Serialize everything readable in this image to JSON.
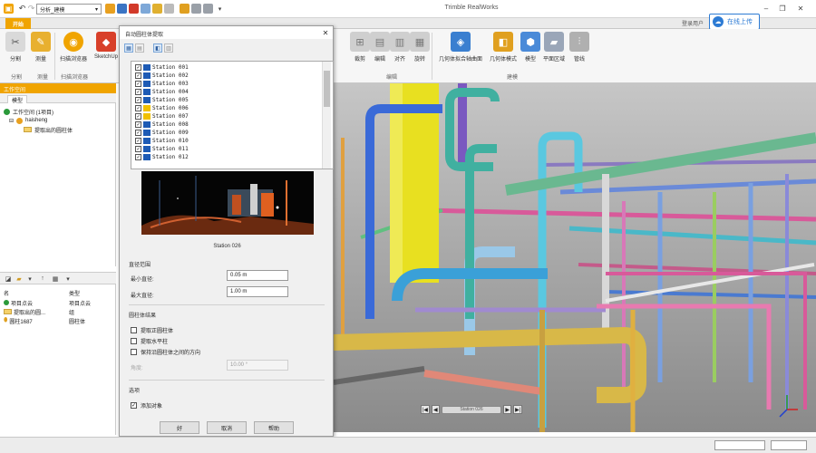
{
  "titlebar": {
    "project_combo": "分析_建模",
    "app_title": "Trimble RealWorks",
    "minimize": "–",
    "restore": "❐",
    "close": "✕"
  },
  "ribbon_tabs": {
    "home": "开始"
  },
  "account": {
    "user": "登录用户",
    "login_label": "在线上传"
  },
  "ribbon": {
    "left_buttons": [
      {
        "label": "分割",
        "icon": "cut-icon"
      },
      {
        "label": "测量",
        "icon": "measure-icon"
      },
      {
        "label": "扫描浏览器",
        "icon": "scan-explorer-icon"
      },
      {
        "label": "SketchUp",
        "icon": "sketchup-icon"
      }
    ],
    "left_groups": [
      "分割",
      "测量",
      "扫描浏览器"
    ],
    "right_buttons": [
      {
        "label": "裁剪"
      },
      {
        "label": "编辑"
      },
      {
        "label": "对齐"
      },
      {
        "label": "旋转"
      },
      {
        "label": "几何体拟合轴曲面"
      },
      {
        "label": "几何体模式"
      },
      {
        "label": "模型"
      },
      {
        "label": "平面区域"
      },
      {
        "label": "管线"
      }
    ],
    "right_groups": [
      "编辑",
      "建模"
    ]
  },
  "workspace": {
    "header": "工作空间",
    "tab": "模型",
    "tree": [
      {
        "label": "工作空间 (1项目)",
        "indent": 0
      },
      {
        "label": "haisheng",
        "indent": 1
      },
      {
        "label": "提取出的圆柱体",
        "indent": 2
      }
    ]
  },
  "properties": {
    "col_name": "名",
    "col_type": "类型",
    "rows": [
      {
        "name": "项目点云",
        "type": "项目点云"
      },
      {
        "name": "提取出的圆...",
        "type": "组"
      },
      {
        "name": "圆柱1687",
        "type": "圆柱体"
      }
    ]
  },
  "dialog": {
    "title": "自动圆柱体提取",
    "stations": [
      "Station 001",
      "Station 002",
      "Station 003",
      "Station 004",
      "Station 005",
      "Station 006",
      "Station 007",
      "Station 008",
      "Station 009",
      "Station 010",
      "Station 011",
      "Station 012"
    ],
    "preview_caption": "Station 026",
    "radius_section": "直径范围",
    "min_label": "最小直径:",
    "min_value": "0.05 m",
    "max_label": "最大直径:",
    "max_value": "1.00 m",
    "options_section": "圆柱体结果",
    "opt1": "提取正圆柱体",
    "opt2": "提取水平柱",
    "opt3": "保持沿圆柱体之间的方向",
    "angle_label": "角度:",
    "angle_value": "10.00 °",
    "output_section": "选项",
    "output_check": "添加对象",
    "btn_ok": "好",
    "btn_cancel": "取消",
    "btn_help": "帮助"
  },
  "viewport": {
    "nav_center": "Station 026"
  }
}
